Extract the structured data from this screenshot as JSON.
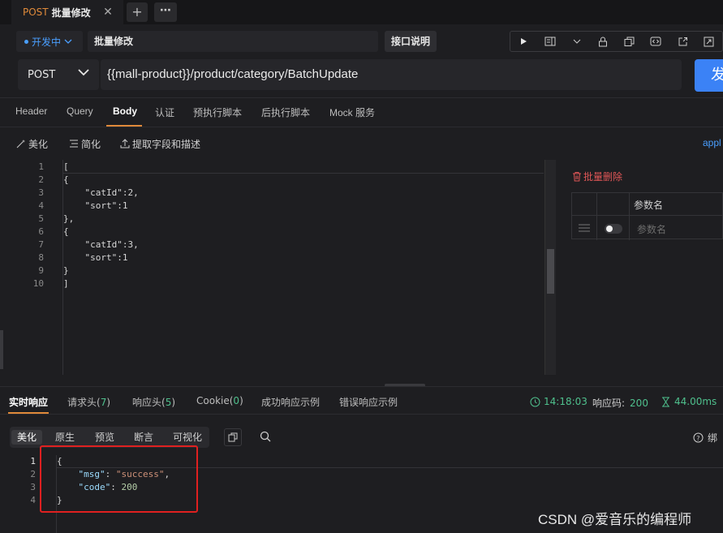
{
  "tabbar": {
    "tab_method": "POST",
    "tab_name": "批量修改",
    "close_glyph": "✕",
    "add_glyph": "+",
    "more_glyph": "⋯"
  },
  "header": {
    "status": "开发中",
    "request_name": "批量修改",
    "doc_button": "接口说明",
    "toolbar_icons": [
      "run-icon",
      "layout-icon",
      "chevron-down-icon",
      "lock-icon",
      "copy-icon",
      "code-icon",
      "share-icon",
      "export-icon"
    ]
  },
  "url_bar": {
    "method": "POST",
    "url": "{{mall-product}}/product/category/BatchUpdate",
    "send_label": "发"
  },
  "request_tabs": [
    {
      "label": "Header"
    },
    {
      "label": "Query"
    },
    {
      "label": "Body"
    },
    {
      "label": "认证"
    },
    {
      "label": "预执行脚本"
    },
    {
      "label": "后执行脚本"
    },
    {
      "label": "Mock 服务"
    }
  ],
  "body_tools": {
    "beautify": "美化",
    "simplify": "简化",
    "extract": "提取字段和描述",
    "content_type_partial": "appl"
  },
  "editor": {
    "line_numbers": [
      "1",
      "2",
      "3",
      "4",
      "5",
      "6",
      "7",
      "8",
      "9",
      "10"
    ],
    "lines": [
      "[",
      "{",
      "    \"catId\":2,",
      "    \"sort\":1",
      "},",
      "{",
      "    \"catId\":3,",
      "    \"sort\":1",
      "}",
      "]"
    ]
  },
  "params": {
    "batch_delete": "批量删除",
    "column_name": "参数名",
    "placeholder": "参数名"
  },
  "response": {
    "tabs": [
      {
        "label": "实时响应",
        "count": ""
      },
      {
        "label": "请求头",
        "count": "7"
      },
      {
        "label": "响应头",
        "count": "5"
      },
      {
        "label": "Cookie",
        "count": "0"
      },
      {
        "label": "成功响应示例",
        "count": ""
      },
      {
        "label": "错误响应示例",
        "count": ""
      }
    ],
    "time": "14:18:03",
    "status_label": "响应码:",
    "status_code": "200",
    "duration": "44.00ms",
    "view_modes": [
      "美化",
      "原生",
      "预览",
      "断言",
      "可视化"
    ],
    "bind_help_partial": "绑",
    "line_numbers": [
      "1",
      "2",
      "3",
      "4"
    ],
    "body": {
      "open": "{",
      "msg_key": "\"msg\"",
      "msg_value": "\"success\"",
      "code_key": "\"code\"",
      "code_value": "200",
      "close": "}"
    }
  },
  "watermark": "CSDN @爱音乐的编程师"
}
